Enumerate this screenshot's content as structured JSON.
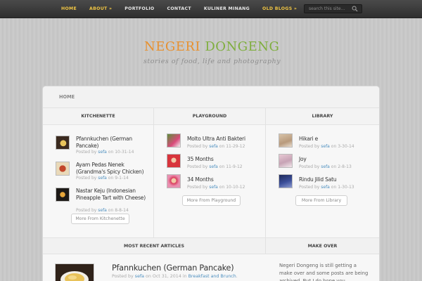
{
  "nav": {
    "items": [
      "HOME",
      "ABOUT »",
      "PORTFOLIO",
      "CONTACT",
      "KULINER MINANG",
      "OLD BLOGS »"
    ],
    "search_placeholder": "search this site..."
  },
  "site": {
    "title_word1": "NEGERI",
    "title_word2": "DONGENG",
    "tagline": "stories of food, life and photography"
  },
  "breadcrumb": "HOME",
  "columns": [
    {
      "heading": "KITCHENETTE",
      "posts": [
        {
          "title": "Pfannkuchen (German Pancake)",
          "by": "Posted by",
          "author": "sefa",
          "on": "on",
          "date": "10-31-14"
        },
        {
          "title": "Ayam Pedas Nenek (Grandma's Spicy Chicken)",
          "by": "Posted by",
          "author": "sefa",
          "on": "on",
          "date": "9-1-14"
        },
        {
          "title": "Nastar Keju (Indonesian Pineapple Tart with Cheese)",
          "by": "Posted by",
          "author": "sefa",
          "on": "on",
          "date": "8-8-14"
        }
      ],
      "more": "More From Kitchenette"
    },
    {
      "heading": "PLAYGROUND",
      "posts": [
        {
          "title": "Molto Ultra Anti Bakteri",
          "by": "Posted by",
          "author": "sefa",
          "on": "on",
          "date": "11-29-12"
        },
        {
          "title": "35 Months",
          "by": "Posted by",
          "author": "sefa",
          "on": "on",
          "date": "11-9-12"
        },
        {
          "title": "34 Months",
          "by": "Posted by",
          "author": "sefa",
          "on": "on",
          "date": "10-10-12"
        }
      ],
      "more": "More From Playground"
    },
    {
      "heading": "LIBRARY",
      "posts": [
        {
          "title": "Hikari e",
          "by": "Posted by",
          "author": "sefa",
          "on": "on",
          "date": "3-30-14"
        },
        {
          "title": "Joy",
          "by": "Posted by",
          "author": "sefa",
          "on": "on",
          "date": "2-8-13"
        },
        {
          "title": "Rindu Jilid Satu",
          "by": "Posted by",
          "author": "sefa",
          "on": "on",
          "date": "1-30-13"
        }
      ],
      "more": "More From Library"
    }
  ],
  "recent": {
    "heading": "MOST RECENT ARTICLES",
    "title": "Pfannkuchen (German Pancake)",
    "meta_prefix": "Posted by",
    "author": "sefa",
    "meta_mid": "on Oct 31, 2014 in",
    "category": "Breakfast and Brunch",
    "meta_suffix": "."
  },
  "makeover": {
    "heading": "MAKE OVER",
    "text": "Negeri Dongeng is still getting a make over and some posts are being archived. But I do hope you"
  },
  "colors": {
    "accent_nav": "#f1c644",
    "title_orange": "#e8912f",
    "title_green": "#7fae3e",
    "link_blue": "#4d8fbf"
  }
}
